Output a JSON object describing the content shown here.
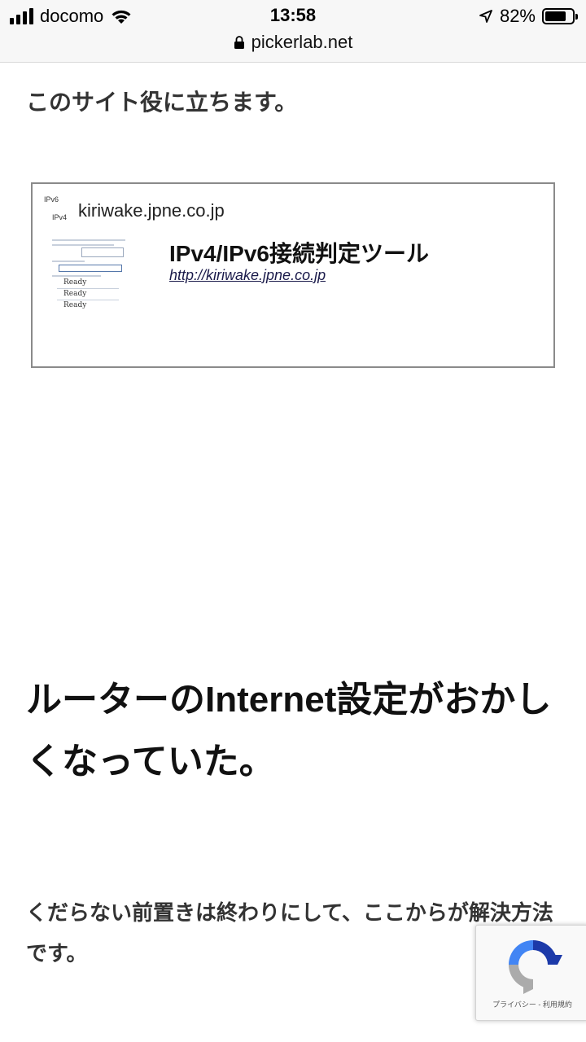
{
  "status_bar": {
    "carrier": "docomo",
    "time": "13:58",
    "battery_percent": "82%",
    "battery_level": 0.82,
    "url": "pickerlab.net"
  },
  "content": {
    "intro": "このサイト役に立ちます。",
    "link_card": {
      "favicon_line1": "IPv6",
      "favicon_line2": "IPv4",
      "domain": "kiriwake.jpne.co.jp",
      "title": "IPv4/IPv6接続判定ツール",
      "url": "http://kiriwake.jpne.co.jp",
      "thumb_ready_label": "Ready"
    },
    "heading": "ルーターのInternet設定がおかしくなっていた。",
    "paragraph": "くだらない前置きは終わりにして、ここからが解決方法です。"
  },
  "recaptcha": {
    "links": "プライバシー - 利用規約"
  },
  "colors": {
    "status_bg": "#f7f7f7",
    "heading": "#111111",
    "link": "#1a1a4a"
  }
}
